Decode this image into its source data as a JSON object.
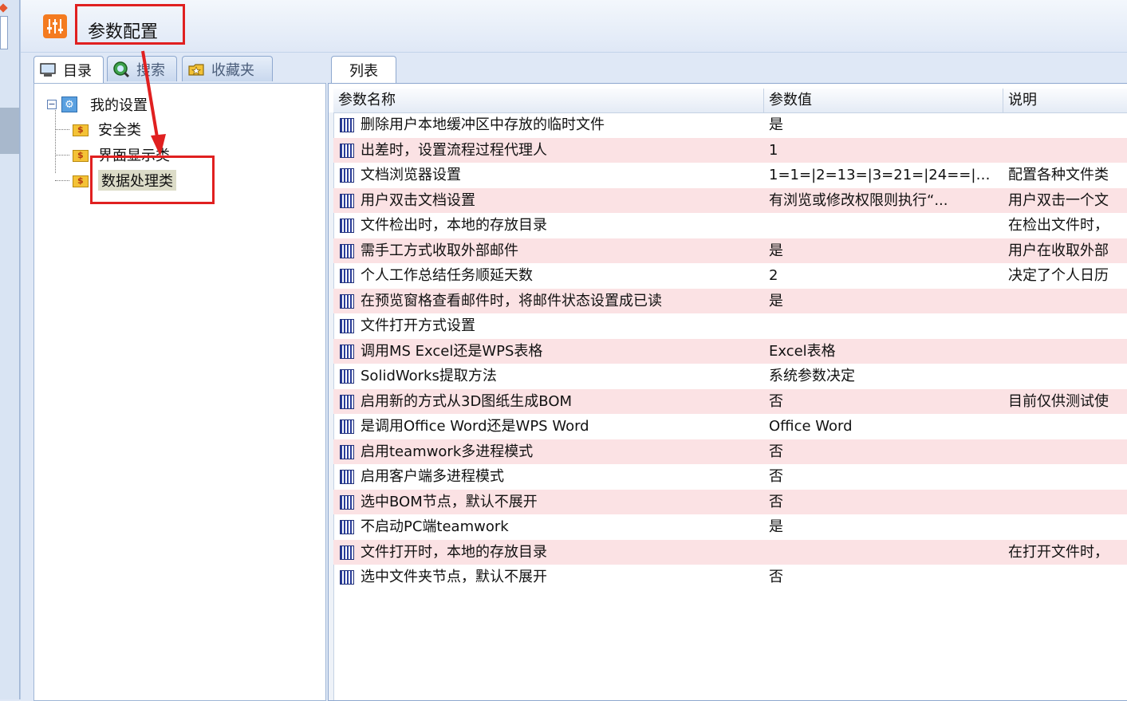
{
  "header": {
    "title": "参数配置"
  },
  "left_tabs": [
    {
      "label": "目录"
    },
    {
      "label": "搜索"
    },
    {
      "label": "收藏夹"
    }
  ],
  "tree": {
    "root": "我的设置",
    "children": [
      "安全类",
      "界面显示类",
      "数据处理类"
    ]
  },
  "right_tab": {
    "label": "列表"
  },
  "grid": {
    "columns": [
      "参数名称",
      "参数值",
      "说明"
    ],
    "rows": [
      {
        "name": "删除用户本地缓冲区中存放的临时文件",
        "value": "是",
        "desc": ""
      },
      {
        "name": "出差时，设置流程过程代理人",
        "value": "1",
        "desc": ""
      },
      {
        "name": "文档浏览器设置",
        "value": "1=1=|2=13=|3=21=|24==|5...",
        "desc": "配置各种文件类"
      },
      {
        "name": "用户双击文档设置",
        "value": "有浏览或修改权限则执行“...",
        "desc": "用户双击一个文"
      },
      {
        "name": "文件检出时，本地的存放目录",
        "value": "",
        "desc": "在检出文件时，"
      },
      {
        "name": "需手工方式收取外部邮件",
        "value": "是",
        "desc": "用户在收取外部"
      },
      {
        "name": "个人工作总结任务顺延天数",
        "value": "2",
        "desc": "决定了个人日历"
      },
      {
        "name": "在预览窗格查看邮件时，将邮件状态设置成已读",
        "value": "是",
        "desc": ""
      },
      {
        "name": "文件打开方式设置",
        "value": "",
        "desc": ""
      },
      {
        "name": "调用MS Excel还是WPS表格",
        "value": "Excel表格",
        "desc": ""
      },
      {
        "name": "SolidWorks提取方法",
        "value": "系统参数决定",
        "desc": ""
      },
      {
        "name": "启用新的方式从3D图纸生成BOM",
        "value": "否",
        "desc": "目前仅供测试使"
      },
      {
        "name": "是调用Office Word还是WPS Word",
        "value": "Office Word",
        "desc": ""
      },
      {
        "name": "启用teamwork多进程模式",
        "value": "否",
        "desc": ""
      },
      {
        "name": "启用客户端多进程模式",
        "value": "否",
        "desc": ""
      },
      {
        "name": "选中BOM节点，默认不展开",
        "value": "否",
        "desc": ""
      },
      {
        "name": "不启动PC端teamwork",
        "value": "是",
        "desc": ""
      },
      {
        "name": "文件打开时，本地的存放目录",
        "value": "",
        "desc": "在打开文件时，"
      },
      {
        "name": "选中文件夹节点，默认不展开",
        "value": "否",
        "desc": ""
      }
    ]
  },
  "colors": {
    "highlight": "#e02020",
    "row_alt": "#fbe2e4",
    "header_icon": "#f47b20"
  }
}
